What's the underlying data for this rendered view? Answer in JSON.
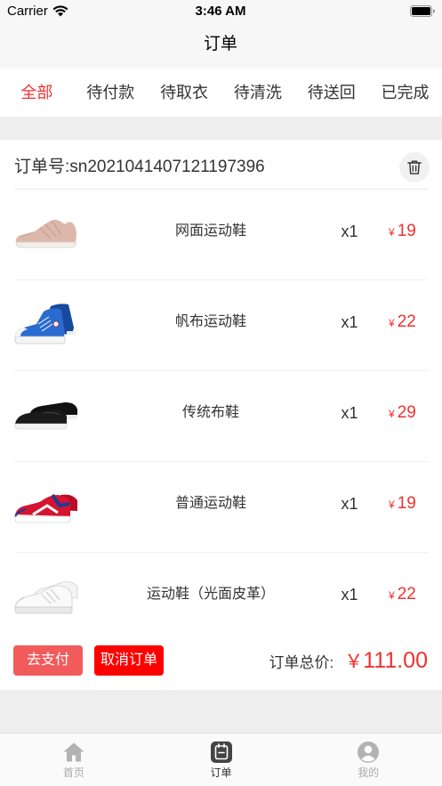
{
  "status_bar": {
    "carrier": "Carrier",
    "time": "3:46 AM"
  },
  "nav": {
    "title": "订单"
  },
  "tabs": [
    {
      "label": "全部"
    },
    {
      "label": "待付款"
    },
    {
      "label": "待取衣"
    },
    {
      "label": "待清洗"
    },
    {
      "label": "待送回"
    },
    {
      "label": "已完成"
    }
  ],
  "active_tab_index": 0,
  "order": {
    "number_label": "订单号:",
    "number": "sn2021041407121197396",
    "delete_icon": "trash-icon",
    "items": [
      {
        "image": "pink-mesh-running-shoe",
        "name": "网面运动鞋",
        "qty": "x1",
        "currency": "¥",
        "price": "19"
      },
      {
        "image": "blue-canvas-high-top-shoe",
        "name": "帆布运动鞋",
        "qty": "x1",
        "currency": "¥",
        "price": "22"
      },
      {
        "image": "black-cloth-shoe",
        "name": "传统布鞋",
        "qty": "x1",
        "currency": "¥",
        "price": "29"
      },
      {
        "image": "red-blue-sneaker",
        "name": "普通运动鞋",
        "qty": "x1",
        "currency": "¥",
        "price": "19"
      },
      {
        "image": "white-leather-sneaker",
        "name": "运动鞋（光面皮革）",
        "qty": "x1",
        "currency": "¥",
        "price": "22"
      }
    ],
    "pay_button": "去支付",
    "cancel_button": "取消订单",
    "total_label": "订单总价:",
    "total_currency": "￥",
    "total": "111.00"
  },
  "tabbar": {
    "active_index": 1,
    "items": [
      {
        "label": "首页",
        "icon": "home-icon"
      },
      {
        "label": "订单",
        "icon": "order-icon"
      },
      {
        "label": "我的",
        "icon": "profile-icon"
      }
    ]
  },
  "colors": {
    "accent": "#f0302f",
    "pay_button": "#f25b5b",
    "cancel_button": "#ff0000"
  }
}
